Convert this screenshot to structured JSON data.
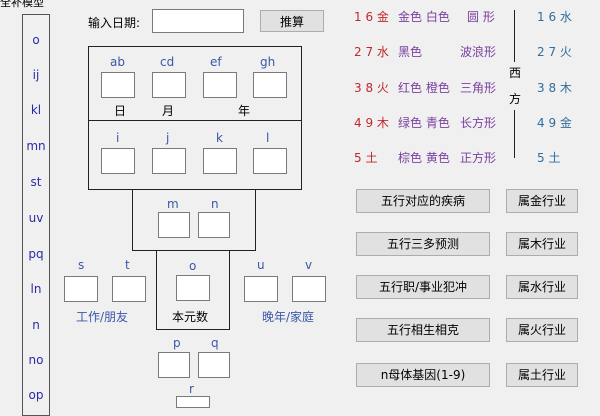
{
  "window": {
    "title": "全补模型"
  },
  "date_row": {
    "label": "输入日期:",
    "input_value": "",
    "calc_button": "推算"
  },
  "left_list": [
    "o",
    "ij",
    "kl",
    "mn",
    "st",
    "uv",
    "pq",
    "ln",
    "n",
    "no",
    "op"
  ],
  "grid_top": {
    "labels": [
      "ab",
      "cd",
      "ef",
      "gh"
    ],
    "units": [
      "日",
      "月",
      "年"
    ]
  },
  "grid_mid": {
    "labels": [
      "i",
      "j",
      "k",
      "l"
    ]
  },
  "mn": {
    "labels": [
      "m",
      "n"
    ]
  },
  "center": {
    "s": "s",
    "t": "t",
    "o": "o",
    "u": "u",
    "v": "v",
    "work_friend": "工作/朋友",
    "core_number": "本元数",
    "late_family": "晚年/家庭"
  },
  "pq": {
    "labels": [
      "p",
      "q"
    ]
  },
  "r": {
    "label": "r"
  },
  "elements": {
    "rows": [
      {
        "num": "1 6 金",
        "colors": "金色 白色",
        "shape": "圆 形"
      },
      {
        "num": "2 7 水",
        "colors": "黑色",
        "shape": "波浪形"
      },
      {
        "num": "3 8 火",
        "colors": "红色 橙色",
        "shape": "三角形"
      },
      {
        "num": "4 9 木",
        "colors": "绿色 青色",
        "shape": "长方形"
      },
      {
        "num": "5  土",
        "colors": "棕色 黄色",
        "shape": "正方形"
      }
    ],
    "west": [
      "西",
      "方"
    ],
    "right": [
      "1 6 水",
      "2 7 火",
      "3 8 木",
      "4 9 金",
      "5  土"
    ]
  },
  "buttons": {
    "left": [
      "五行对应的疾病",
      "五行三多预测",
      "五行职/事业犯冲",
      "五行相生相克",
      "n母体基因(1-9)"
    ],
    "right": [
      "属金行业",
      "属木行业",
      "属水行业",
      "属火行业",
      "属土行业"
    ]
  },
  "colors": {
    "red": "#c0282a",
    "blue": "#3a57a8",
    "purple": "#7b3fa0"
  }
}
